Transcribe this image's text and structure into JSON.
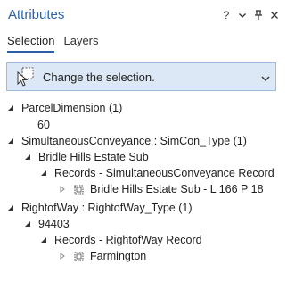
{
  "panel": {
    "title": "Attributes",
    "controls": {
      "help": "?",
      "menu": "options",
      "pin": "auto-hide",
      "close": "close"
    }
  },
  "tabs": [
    {
      "label": "Selection",
      "active": true
    },
    {
      "label": "Layers",
      "active": false
    }
  ],
  "selection_tool": {
    "label": "Change the selection.",
    "icon": "select-cursor-icon"
  },
  "tree": {
    "parcel_dimension": {
      "label": "ParcelDimension (1)",
      "child": "60"
    },
    "simultaneous_conveyance": {
      "label": "SimultaneousConveyance : SimCon_Type (1)",
      "child": "Bridle Hills Estate Sub",
      "records": "Records - SimultaneousConveyance Record",
      "record_item": "Bridle Hills Estate Sub - L 166 P 18"
    },
    "right_of_way": {
      "label": "RightofWay : RightofWay_Type (1)",
      "child": "94403",
      "records": "Records - RightofWay Record",
      "record_item": "Farmington"
    }
  },
  "colors": {
    "accent": "#2b5fa6",
    "tool_bar_bg": "#dce8f5",
    "tool_bar_border": "#9cbde0"
  }
}
